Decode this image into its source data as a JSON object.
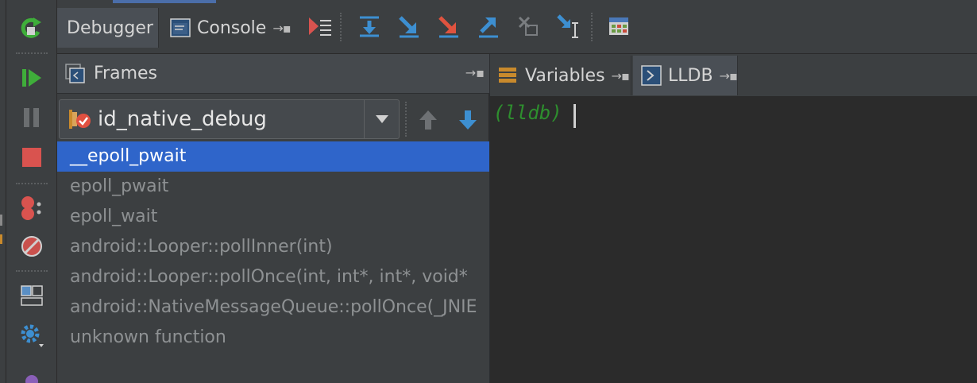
{
  "tabs": {
    "debugger": "Debugger",
    "console": "Console"
  },
  "frames_panel": {
    "title": "Frames",
    "thread": "id_native_debug",
    "frames": [
      "__epoll_pwait",
      "epoll_pwait",
      "epoll_wait",
      "android::Looper::pollInner(int)",
      "android::Looper::pollOnce(int, int*, int*, void*",
      "android::NativeMessageQueue::pollOnce(_JNIE",
      "unknown function"
    ],
    "selected_index": 0
  },
  "right_panel": {
    "variables_tab": "Variables",
    "lldb_tab": "LLDB",
    "prompt": "(lldb)"
  },
  "icons": {
    "rerun": "rerun-icon",
    "resume": "resume-icon",
    "pause": "pause-icon",
    "stop": "stop-icon",
    "breakpoints": "view-breakpoints-icon",
    "mute": "mute-breakpoints-icon",
    "layout": "restore-layout-icon",
    "settings": "settings-icon",
    "show_execution_point": "show-execution-point-icon",
    "step_over": "step-over-icon",
    "step_into": "step-into-icon",
    "force_step_into": "force-step-into-icon",
    "step_out": "step-out-icon",
    "drop_frame": "drop-frame-icon",
    "run_to_cursor": "run-to-cursor-icon",
    "evaluate": "evaluate-expression-icon"
  },
  "colors": {
    "selection": "#2f65ca",
    "prompt_green": "#2e8f2e",
    "panel_bg": "#3c3f41",
    "console_bg": "#2b2b2b"
  }
}
